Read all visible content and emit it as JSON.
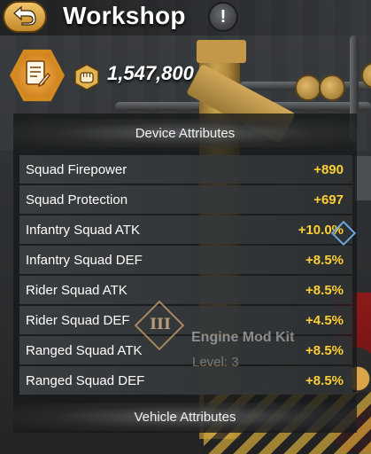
{
  "header": {
    "title": "Workshop",
    "back_icon": "back-arrow-icon",
    "info_label": "!"
  },
  "resources": {
    "badge_icon": "document-pencil-icon",
    "currency_icon": "fist-icon",
    "amount": "1,547,800"
  },
  "device_attributes": {
    "heading": "Device Attributes",
    "rows": [
      {
        "label": "Squad Firepower",
        "value": "+890"
      },
      {
        "label": "Squad Protection",
        "value": "+697"
      },
      {
        "label": "Infantry Squad ATK",
        "value": "+10.0%"
      },
      {
        "label": "Infantry Squad DEF",
        "value": "+8.5%"
      },
      {
        "label": "Rider Squad ATK",
        "value": "+8.5%"
      },
      {
        "label": "Rider Squad DEF",
        "value": "+4.5%"
      },
      {
        "label": "Ranged Squad ATK",
        "value": "+8.5%"
      },
      {
        "label": "Ranged Squad DEF",
        "value": "+8.5%"
      }
    ]
  },
  "vehicle_attributes": {
    "heading": "Vehicle Attributes"
  },
  "selected_item": {
    "emblem": "III",
    "name": "Engine Mod Kit",
    "level": "Level: 3"
  },
  "colors": {
    "accent_gold": "#ffcf34",
    "badge_orange": "#d58a1e"
  }
}
